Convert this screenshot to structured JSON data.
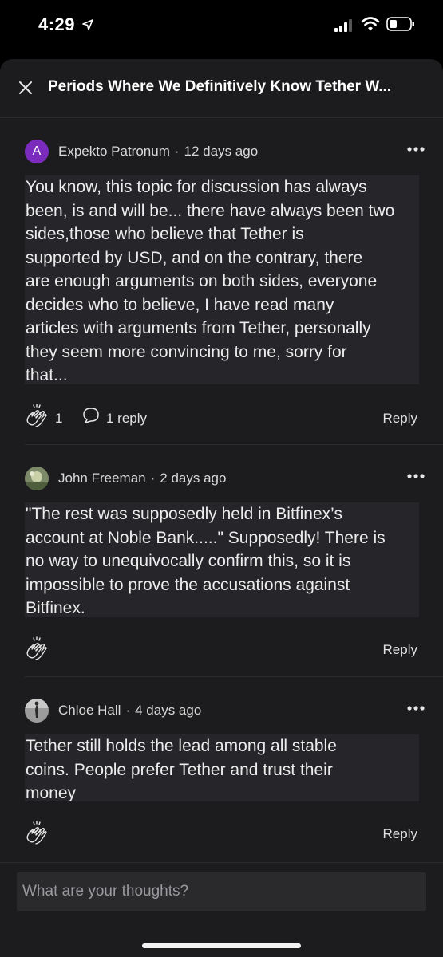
{
  "status_bar": {
    "time": "4:29",
    "icons": [
      "location-arrow-icon",
      "cellular-signal-icon",
      "wifi-icon",
      "battery-icon"
    ]
  },
  "header": {
    "title": "Periods Where We Definitively Know Tether W...",
    "close_icon": "close-icon"
  },
  "comments": [
    {
      "avatar_letter": "A",
      "avatar_color": "#7b2cbf",
      "author": "Expekto Patronum",
      "time": "12 days ago",
      "body": "You know, this topic for discussion has always\nbeen, is and will be... there have always been two\nsides,those who believe that Tether is\nsupported by USD, and on the contrary, there\nare enough arguments on both sides, everyone\ndecides who to believe, I have read many\narticles with arguments from Tether, personally\nthey seem more convincing to me, sorry for\nthat...",
      "claps": "1",
      "replies": "1 reply",
      "reply_label": "Reply"
    },
    {
      "avatar_letter": "",
      "avatar_color": "#6b7a5a",
      "author": "John Freeman",
      "time": "2 days ago",
      "body": "\"The rest was supposedly held in Bitfinex’s\naccount at Noble Bank.....\" Supposedly! There is\nno way to unequivocally confirm this, so it is\nimpossible to prove the accusations against\nBitfinex.",
      "reply_label": "Reply"
    },
    {
      "avatar_letter": "",
      "avatar_color": "#8a8a8a",
      "author": "Chloe Hall",
      "time": "4 days ago",
      "body": "Tether still holds the lead among all stable\ncoins. People prefer Tether and trust their\nmoney",
      "reply_label": "Reply"
    }
  ],
  "composer": {
    "placeholder": "What are your thoughts?"
  }
}
